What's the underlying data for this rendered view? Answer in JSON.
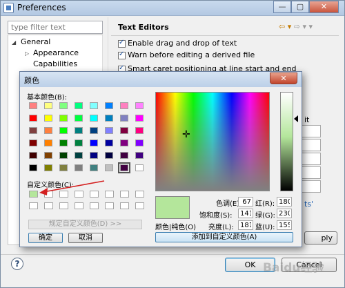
{
  "preferences": {
    "title": "Preferences",
    "faded_title": "",
    "filter_placeholder": "type filter text",
    "tree": [
      {
        "label": "General",
        "indent": 0
      },
      {
        "label": "Appearance",
        "indent": 1
      },
      {
        "label": "Capabilities",
        "indent": 1
      }
    ],
    "page_title": "Text Editors",
    "options": [
      "Enable drag and drop of text",
      "Warn before editing a derived file",
      "Smart caret positioning at line start and end"
    ],
    "apply_label": "ply",
    "ok_label": "OK",
    "cancel_label": "Cancel",
    "window_buttons": [
      "—",
      "▢",
      "✕"
    ]
  },
  "color_dialog": {
    "title": "颜色",
    "close_label": "✕",
    "basic_colors_label": "基本颜色(B):",
    "custom_colors_label": "自定义颜色(C):",
    "define_custom_button": "规定自定义颜色(D) >>",
    "ok_button": "确定",
    "cancel_button": "取消",
    "color_solid_label": "颜色|纯色(O)",
    "hue_label": "色调(E):",
    "hue_value": "67",
    "sat_label": "饱和度(S):",
    "sat_value": "141",
    "lum_label": "亮度(L):",
    "lum_value": "181",
    "red_label": "红(R):",
    "red_value": "180",
    "green_label": "绿(G):",
    "green_value": "230",
    "blue_label": "蓝(U):",
    "blue_value": "155",
    "add_to_custom_button": "添加到自定义颜色(A)",
    "current_color": "#b4e69b",
    "basic_colors": [
      [
        "#ff8080",
        "#ffff80",
        "#80ff80",
        "#00ff80",
        "#80ffff",
        "#0080ff",
        "#ff80c0",
        "#ff80ff"
      ],
      [
        "#ff0000",
        "#ffff00",
        "#80ff00",
        "#00ff40",
        "#00ffff",
        "#0080c0",
        "#8080c0",
        "#ff00ff"
      ],
      [
        "#804040",
        "#ff8040",
        "#00ff00",
        "#008080",
        "#004080",
        "#8080ff",
        "#800040",
        "#ff0080"
      ],
      [
        "#800000",
        "#ff8000",
        "#008000",
        "#008040",
        "#0000ff",
        "#0000a0",
        "#800080",
        "#8000ff"
      ],
      [
        "#400000",
        "#804000",
        "#004000",
        "#004040",
        "#000080",
        "#000040",
        "#400040",
        "#400080"
      ],
      [
        "#000000",
        "#808000",
        "#808040",
        "#808080",
        "#408080",
        "#c0c0c0",
        "#400040",
        "#ffffff"
      ]
    ],
    "selected_basic": [
      5,
      6
    ],
    "custom_colors": [
      [
        "#b4e69b",
        "#ffffff",
        "#ffffff",
        "#ffffff",
        "#ffffff",
        "#ffffff",
        "#ffffff",
        "#ffffff"
      ],
      [
        "#ffffff",
        "#ffffff",
        "#ffffff",
        "#ffffff",
        "#ffffff",
        "#ffffff",
        "#ffffff",
        "#ffffff"
      ]
    ]
  },
  "watermark": "Baidu经验"
}
